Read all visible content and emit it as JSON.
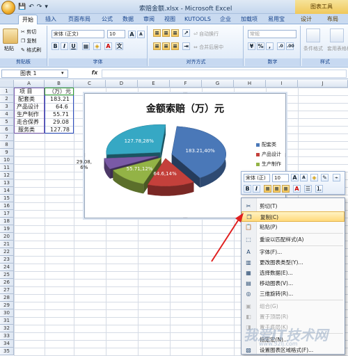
{
  "titlebar": {
    "title": "索赔金额.xlsx - Microsoft Excel",
    "chart_tools": "图表工具"
  },
  "tabs": [
    "开始",
    "插入",
    "页面布局",
    "公式",
    "数据",
    "审阅",
    "视图",
    "KUTOOLS",
    "企业",
    "加载项",
    "易用宝",
    "设计",
    "布局"
  ],
  "ribbon": {
    "paste": "粘贴",
    "cut": "剪切",
    "copy": "复制",
    "format_painter": "格式刷",
    "font_name": "宋体 (正文)",
    "font_size": "10",
    "wrap_text": "自动换行",
    "merge_center": "合并后居中",
    "number_format": "常规",
    "cond_format": "条件格式",
    "table_format": "套用表格格式",
    "group_labels": [
      "剪贴板",
      "字体",
      "对齐方式",
      "数字",
      "样式"
    ],
    "bold": "B",
    "italic": "I",
    "underline": "U"
  },
  "formula_bar": {
    "name_box": "图表 1",
    "fx": "fx"
  },
  "columns": [
    "A",
    "B",
    "C",
    "D",
    "E",
    "F",
    "G",
    "H",
    "I",
    "J"
  ],
  "rows": [
    "1",
    "2",
    "3",
    "4",
    "5",
    "6",
    "7",
    "8",
    "9",
    "10",
    "11",
    "12",
    "13",
    "14",
    "15",
    "16",
    "17",
    "18",
    "19",
    "20",
    "21",
    "22",
    "23",
    "24",
    "25",
    "26",
    "27",
    "28",
    "29",
    "30",
    "31",
    "32",
    "33",
    "34",
    "35"
  ],
  "sheet": {
    "header": [
      "项 目",
      "（万）元"
    ],
    "data": [
      [
        "配套类",
        "183.21"
      ],
      [
        "产品设计",
        "64.6"
      ],
      [
        "生产制作",
        "55.71"
      ],
      [
        "走合保养",
        "29.08"
      ],
      [
        "服务类",
        "127.78"
      ]
    ]
  },
  "chart_data": {
    "type": "pie",
    "title": "金额索赔（万）元",
    "categories": [
      "配套类",
      "产品设计",
      "生产制作",
      "走合保养",
      "服务类"
    ],
    "values": [
      183.21,
      64.6,
      55.71,
      29.08,
      127.78
    ],
    "data_labels": [
      "183.21,40%",
      "64.6,14%",
      "55.71,12%",
      "29.08,\n6%",
      "127.78,28%"
    ],
    "colors": [
      "#4a78b8",
      "#c4403b",
      "#93b346",
      "#7a5aa6",
      "#36a8c4"
    ],
    "legend_entries": [
      "配套类",
      "产品设计",
      "生产制作"
    ],
    "legend_position": "right",
    "style": "3d-exploded"
  },
  "minitoolbar": {
    "font_name": "宋体 (正)",
    "font_size": "10"
  },
  "context_menu": [
    {
      "label": "剪切(T)",
      "icon": "cut-icon",
      "glyph": "✂",
      "enabled": true
    },
    {
      "label": "复制(C)",
      "icon": "copy-icon",
      "glyph": "❐",
      "enabled": true,
      "highlight": true
    },
    {
      "label": "粘贴(P)",
      "icon": "paste-icon",
      "glyph": "📋",
      "enabled": true
    },
    {
      "label": "重设以匹配样式(A)",
      "icon": "reset-style-icon",
      "glyph": "⬚",
      "enabled": true
    },
    {
      "label": "字体(F)...",
      "icon": "font-icon",
      "glyph": "A",
      "enabled": true
    },
    {
      "label": "更改图表类型(Y)...",
      "icon": "chart-type-icon",
      "glyph": "▥",
      "enabled": true
    },
    {
      "label": "选择数据(E)...",
      "icon": "select-data-icon",
      "glyph": "▦",
      "enabled": true
    },
    {
      "label": "移动图表(V)...",
      "icon": "move-chart-icon",
      "glyph": "▤",
      "enabled": true
    },
    {
      "label": "三维旋转(R)...",
      "icon": "rotate-3d-icon",
      "glyph": "◎",
      "enabled": true
    },
    {
      "label": "组合(G)",
      "icon": "group-icon",
      "glyph": "▣",
      "enabled": false
    },
    {
      "label": "置于顶层(R)",
      "icon": "bring-front-icon",
      "glyph": "◧",
      "enabled": false
    },
    {
      "label": "置于底层(K)",
      "icon": "send-back-icon",
      "glyph": "◨",
      "enabled": false
    },
    {
      "label": "指定宏(N)...",
      "icon": "macro-icon",
      "glyph": "",
      "enabled": true
    },
    {
      "label": "设置图表区域格式(F)...",
      "icon": "format-chart-area-icon",
      "glyph": "▧",
      "enabled": true
    }
  ],
  "watermark": {
    "text": "我爱IT技术网",
    "url": "www.52ij.com"
  }
}
